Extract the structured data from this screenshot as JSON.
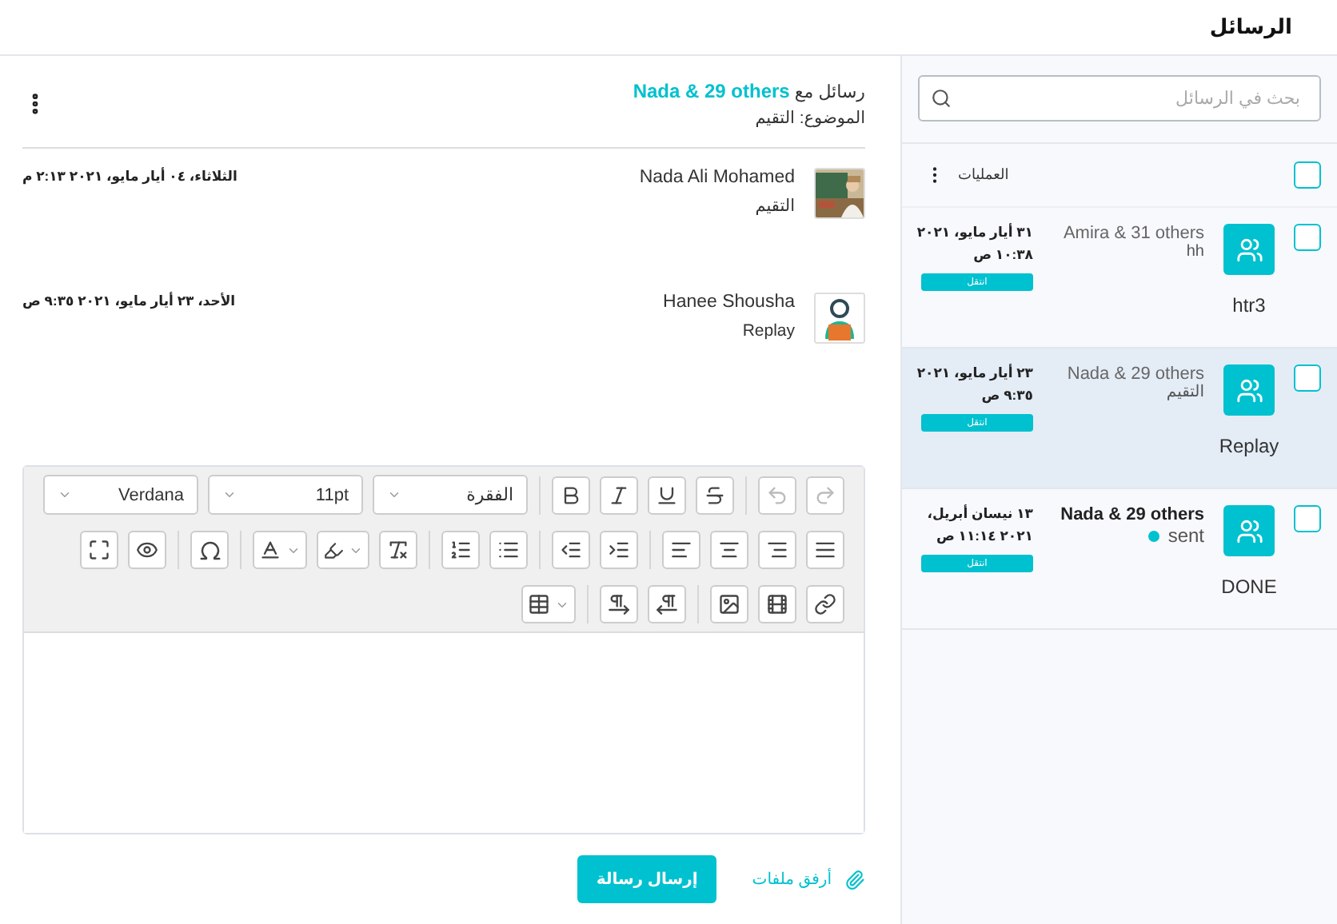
{
  "header": {
    "title": "الرسائل"
  },
  "sidebar": {
    "search": {
      "placeholder": "بحث في الرسائل"
    },
    "select_all": {
      "checked": false
    },
    "actions_label": "العمليات",
    "conversations": [
      {
        "name": "Amira & 31 others",
        "subtitle": "hh",
        "date": "٣١ أيار مايو، ٢٠٢١",
        "time": "١٠:٣٨ ص",
        "badge": "انتقل",
        "preview": "htr3",
        "checked": false,
        "selected": false,
        "unread": false
      },
      {
        "name": "Nada & 29 others",
        "subtitle": "التقيم",
        "date": "٢٣ أيار مايو، ٢٠٢١",
        "time": "٩:٣٥ ص",
        "badge": "انتقل",
        "preview": "Replay",
        "checked": false,
        "selected": true,
        "unread": false
      },
      {
        "name": "Nada & 29 others",
        "subtitle": "sent",
        "date": "١٣ نيسان أبريل،",
        "time": "٢٠٢١ ١١:١٤ ص",
        "badge": "انتقل",
        "preview": "DONE",
        "checked": false,
        "selected": false,
        "unread": true
      }
    ]
  },
  "thread": {
    "with_label": "رسائل مع",
    "with_name": "Nada & 29 others",
    "subject": "الموضوع: التقيم",
    "messages": [
      {
        "sender": "Nada Ali Mohamed",
        "text": "التقيم",
        "date": "الثلاثاء، ٠٤ أيار مايو، ٢٠٢١ ٢:١٣ م"
      },
      {
        "sender": "Hanee Shousha",
        "text": "Replay",
        "date": "الأحد، ٢٣ أيار مايو، ٢٠٢١ ٩:٣٥ ص",
        "kind": "figure"
      }
    ]
  },
  "editor": {
    "selects": [
      "الفقرة",
      "11pt",
      "Verdana"
    ],
    "undo_disabled": true,
    "redo_disabled": true
  },
  "footer": {
    "attach": "أرفق ملفات",
    "send": "إرسال رسالة"
  }
}
